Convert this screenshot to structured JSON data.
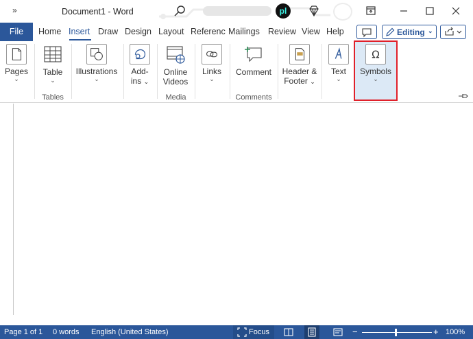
{
  "titlebar": {
    "overflow": "»",
    "title": "Document1  -  Word",
    "brand_logo": "pl",
    "icons": [
      "search-icon",
      "diamond-icon",
      "restore-ribbon-icon",
      "minimize-icon",
      "maximize-icon",
      "close-icon"
    ]
  },
  "tabs": {
    "file": "File",
    "items": [
      "Home",
      "Insert",
      "Draw",
      "Design",
      "Layout",
      "Referenc",
      "Mailings",
      "Review",
      "View",
      "Help"
    ],
    "active": "Insert",
    "editing": "Editing"
  },
  "ribbon": {
    "pages": "Pages",
    "table": "Table",
    "illustrations": "Illustrations",
    "addins_1": "Add-",
    "addins_2": "ins",
    "online_1": "Online",
    "online_2": "Videos",
    "links": "Links",
    "comment": "Comment",
    "header_1": "Header &",
    "header_2": "Footer",
    "text": "Text",
    "symbols": "Symbols",
    "groups": {
      "tables": "Tables",
      "media": "Media",
      "comments": "Comments"
    }
  },
  "statusbar": {
    "page": "Page 1 of 1",
    "words": "0 words",
    "language": "English (United States)",
    "focus": "Focus",
    "zoom_minus": "−",
    "zoom_plus": "+",
    "zoom": "100%"
  },
  "colors": {
    "accent": "#2b579a",
    "highlight": "#e0202a"
  }
}
